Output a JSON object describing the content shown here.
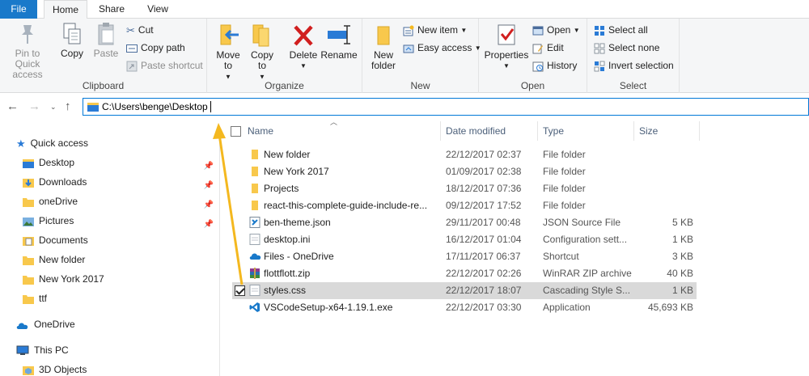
{
  "tabs": {
    "file": "File",
    "home": "Home",
    "share": "Share",
    "view": "View"
  },
  "ribbon": {
    "clipboard": {
      "label": "Clipboard",
      "pin": "Pin to Quick access",
      "copy": "Copy",
      "paste": "Paste",
      "cut": "Cut",
      "copy_path": "Copy path",
      "paste_shortcut": "Paste shortcut"
    },
    "organize": {
      "label": "Organize",
      "move_to": "Move to",
      "copy_to": "Copy to",
      "delete": "Delete",
      "rename": "Rename"
    },
    "new": {
      "label": "New",
      "new_folder": "New folder",
      "new_item": "New item",
      "easy_access": "Easy access"
    },
    "open": {
      "label": "Open",
      "properties": "Properties",
      "open": "Open",
      "edit": "Edit",
      "history": "History"
    },
    "select": {
      "label": "Select",
      "select_all": "Select all",
      "select_none": "Select none",
      "invert": "Invert selection"
    }
  },
  "address": {
    "path": "C:\\Users\\benge\\Desktop"
  },
  "sidebar": {
    "quick_access": "Quick access",
    "items": [
      "Desktop",
      "Downloads",
      "oneDrive",
      "Pictures",
      "Documents",
      "New folder",
      "New York 2017",
      "ttf"
    ],
    "onedrive": "OneDrive",
    "this_pc": "This PC",
    "objects3d": "3D Objects"
  },
  "columns": {
    "name": "Name",
    "date": "Date modified",
    "type": "Type",
    "size": "Size"
  },
  "files": [
    {
      "name": "New folder",
      "date": "22/12/2017 02:37",
      "type": "File folder",
      "size": "",
      "icon": "folder-icon"
    },
    {
      "name": "New York 2017",
      "date": "01/09/2017 02:38",
      "type": "File folder",
      "size": "",
      "icon": "folder-icon"
    },
    {
      "name": "Projects",
      "date": "18/12/2017 07:36",
      "type": "File folder",
      "size": "",
      "icon": "folder-icon"
    },
    {
      "name": "react-this-complete-guide-include-re...",
      "date": "09/12/2017 17:52",
      "type": "File folder",
      "size": "",
      "icon": "folder-icon"
    },
    {
      "name": "ben-theme.json",
      "date": "29/11/2017 00:48",
      "type": "JSON Source File",
      "size": "5 KB",
      "icon": "json-file-icon"
    },
    {
      "name": "desktop.ini",
      "date": "16/12/2017 01:04",
      "type": "Configuration sett...",
      "size": "1 KB",
      "icon": "ini-file-icon"
    },
    {
      "name": "Files - OneDrive",
      "date": "17/11/2017 06:37",
      "type": "Shortcut",
      "size": "3 KB",
      "icon": "onedrive-shortcut-icon"
    },
    {
      "name": "flottflott.zip",
      "date": "22/12/2017 02:26",
      "type": "WinRAR ZIP archive",
      "size": "40 KB",
      "icon": "zip-archive-icon"
    },
    {
      "name": "styles.css",
      "date": "22/12/2017 18:07",
      "type": "Cascading Style S...",
      "size": "1 KB",
      "icon": "css-file-icon"
    },
    {
      "name": "VSCodeSetup-x64-1.19.1.exe",
      "date": "22/12/2017 03:30",
      "type": "Application",
      "size": "45,693 KB",
      "icon": "vscode-exe-icon"
    }
  ],
  "colors": {
    "accent": "#1979ca",
    "folder": "#f8c84c",
    "annotation": "#f4b81f",
    "selected_row": "#d9d9d9"
  }
}
